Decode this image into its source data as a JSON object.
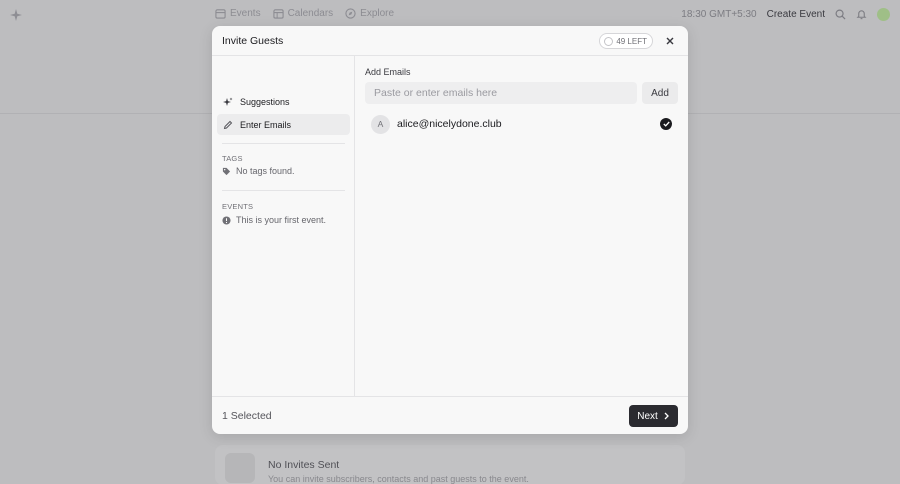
{
  "background": {
    "nav": [
      {
        "label": "Events",
        "icon": "calendar-icon"
      },
      {
        "label": "Calendars",
        "icon": "calendar-grid-icon"
      },
      {
        "label": "Explore",
        "icon": "compass-icon"
      }
    ],
    "time": "18:30 GMT+5:30",
    "create_event": "Create Event",
    "card_title": "No Invites Sent",
    "card_subtitle": "You can invite subscribers, contacts and past guests to the event."
  },
  "modal": {
    "title": "Invite Guests",
    "quota": "49 LEFT",
    "sidebar": {
      "items": [
        {
          "label": "Suggestions",
          "icon": "sparkle-icon"
        },
        {
          "label": "Enter Emails",
          "icon": "pencil-icon"
        }
      ],
      "tags_heading": "TAGS",
      "tags_empty": "No tags found.",
      "events_heading": "EVENTS",
      "events_empty": "This is your first event."
    },
    "main": {
      "add_label": "Add Emails",
      "input_placeholder": "Paste or enter emails here",
      "add_button": "Add",
      "emails": [
        {
          "initial": "A",
          "email": "alice@nicelydone.club",
          "checked": true
        }
      ]
    },
    "footer": {
      "selected": "1 Selected",
      "next": "Next"
    }
  }
}
